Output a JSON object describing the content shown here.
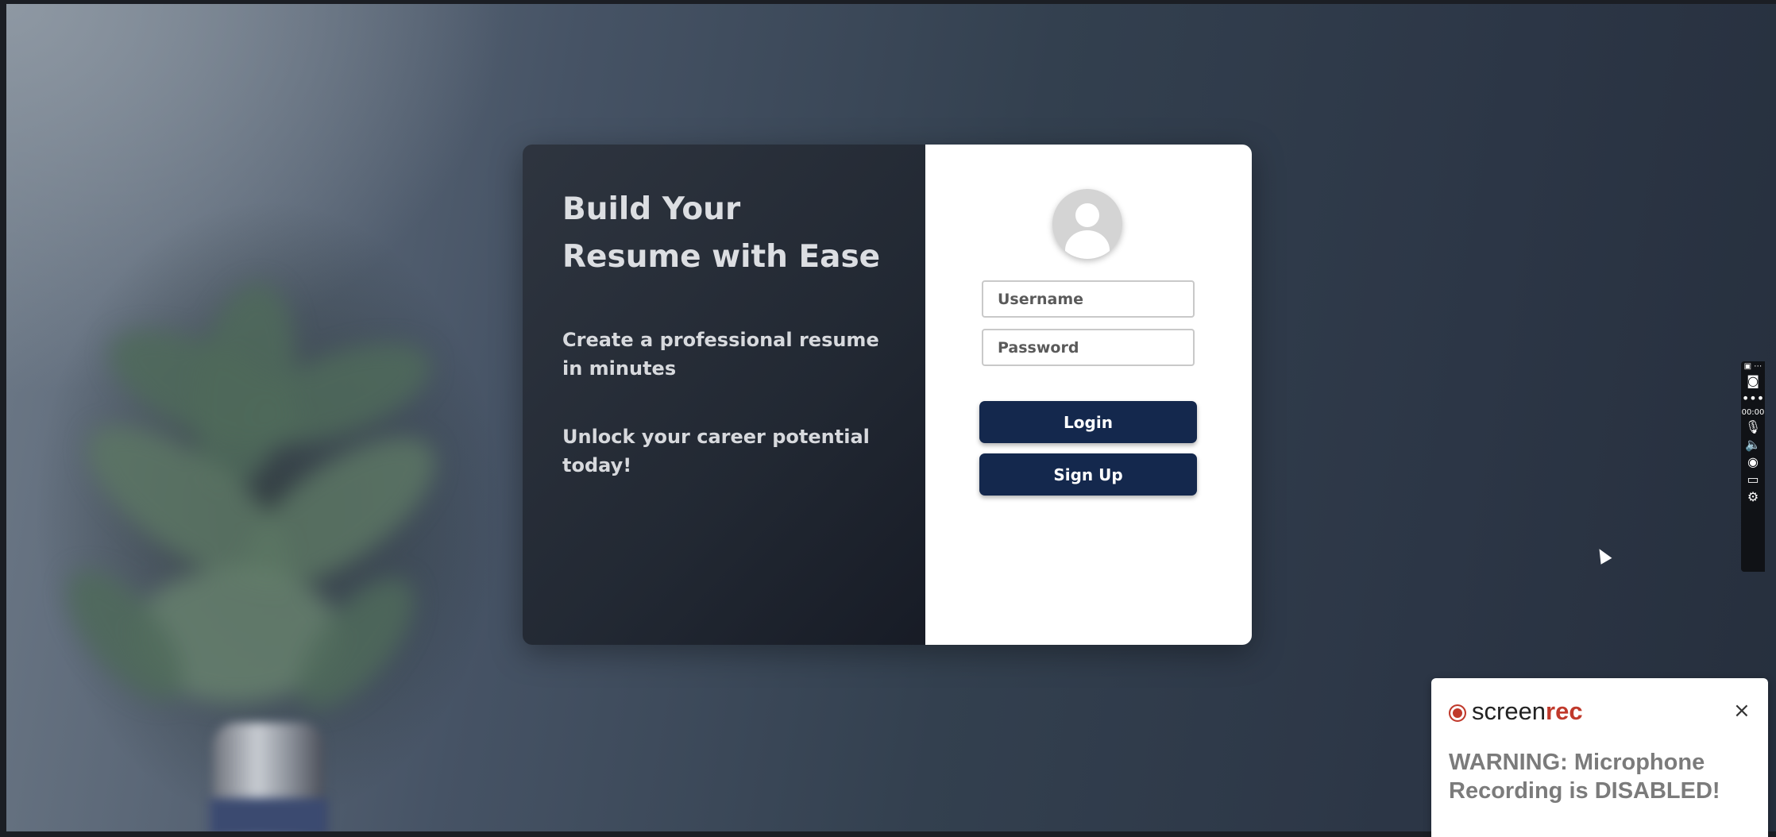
{
  "hero": {
    "headline": "Build Your Resume with Ease",
    "tagline_1": "Create a professional resume in minutes",
    "tagline_2": "Unlock your career potential today!"
  },
  "login_form": {
    "username_placeholder": "Username",
    "password_placeholder": "Password",
    "login_label": "Login",
    "signup_label": "Sign Up"
  },
  "recorder_toolbar": {
    "timer": "00:00",
    "icons": [
      "window-icon",
      "camera-icon",
      "more-icon",
      "microphone-icon",
      "speaker-icon",
      "webcam-icon",
      "screen-icon",
      "gear-icon"
    ]
  },
  "notification": {
    "brand_main": "screen",
    "brand_accent": "rec",
    "warning": "WARNING: Microphone Recording is DISABLED!",
    "close_symbol": "×"
  },
  "colors": {
    "button_bg": "#14284d",
    "brand_accent": "#c0392b",
    "panel_dark": "#2c323c"
  }
}
